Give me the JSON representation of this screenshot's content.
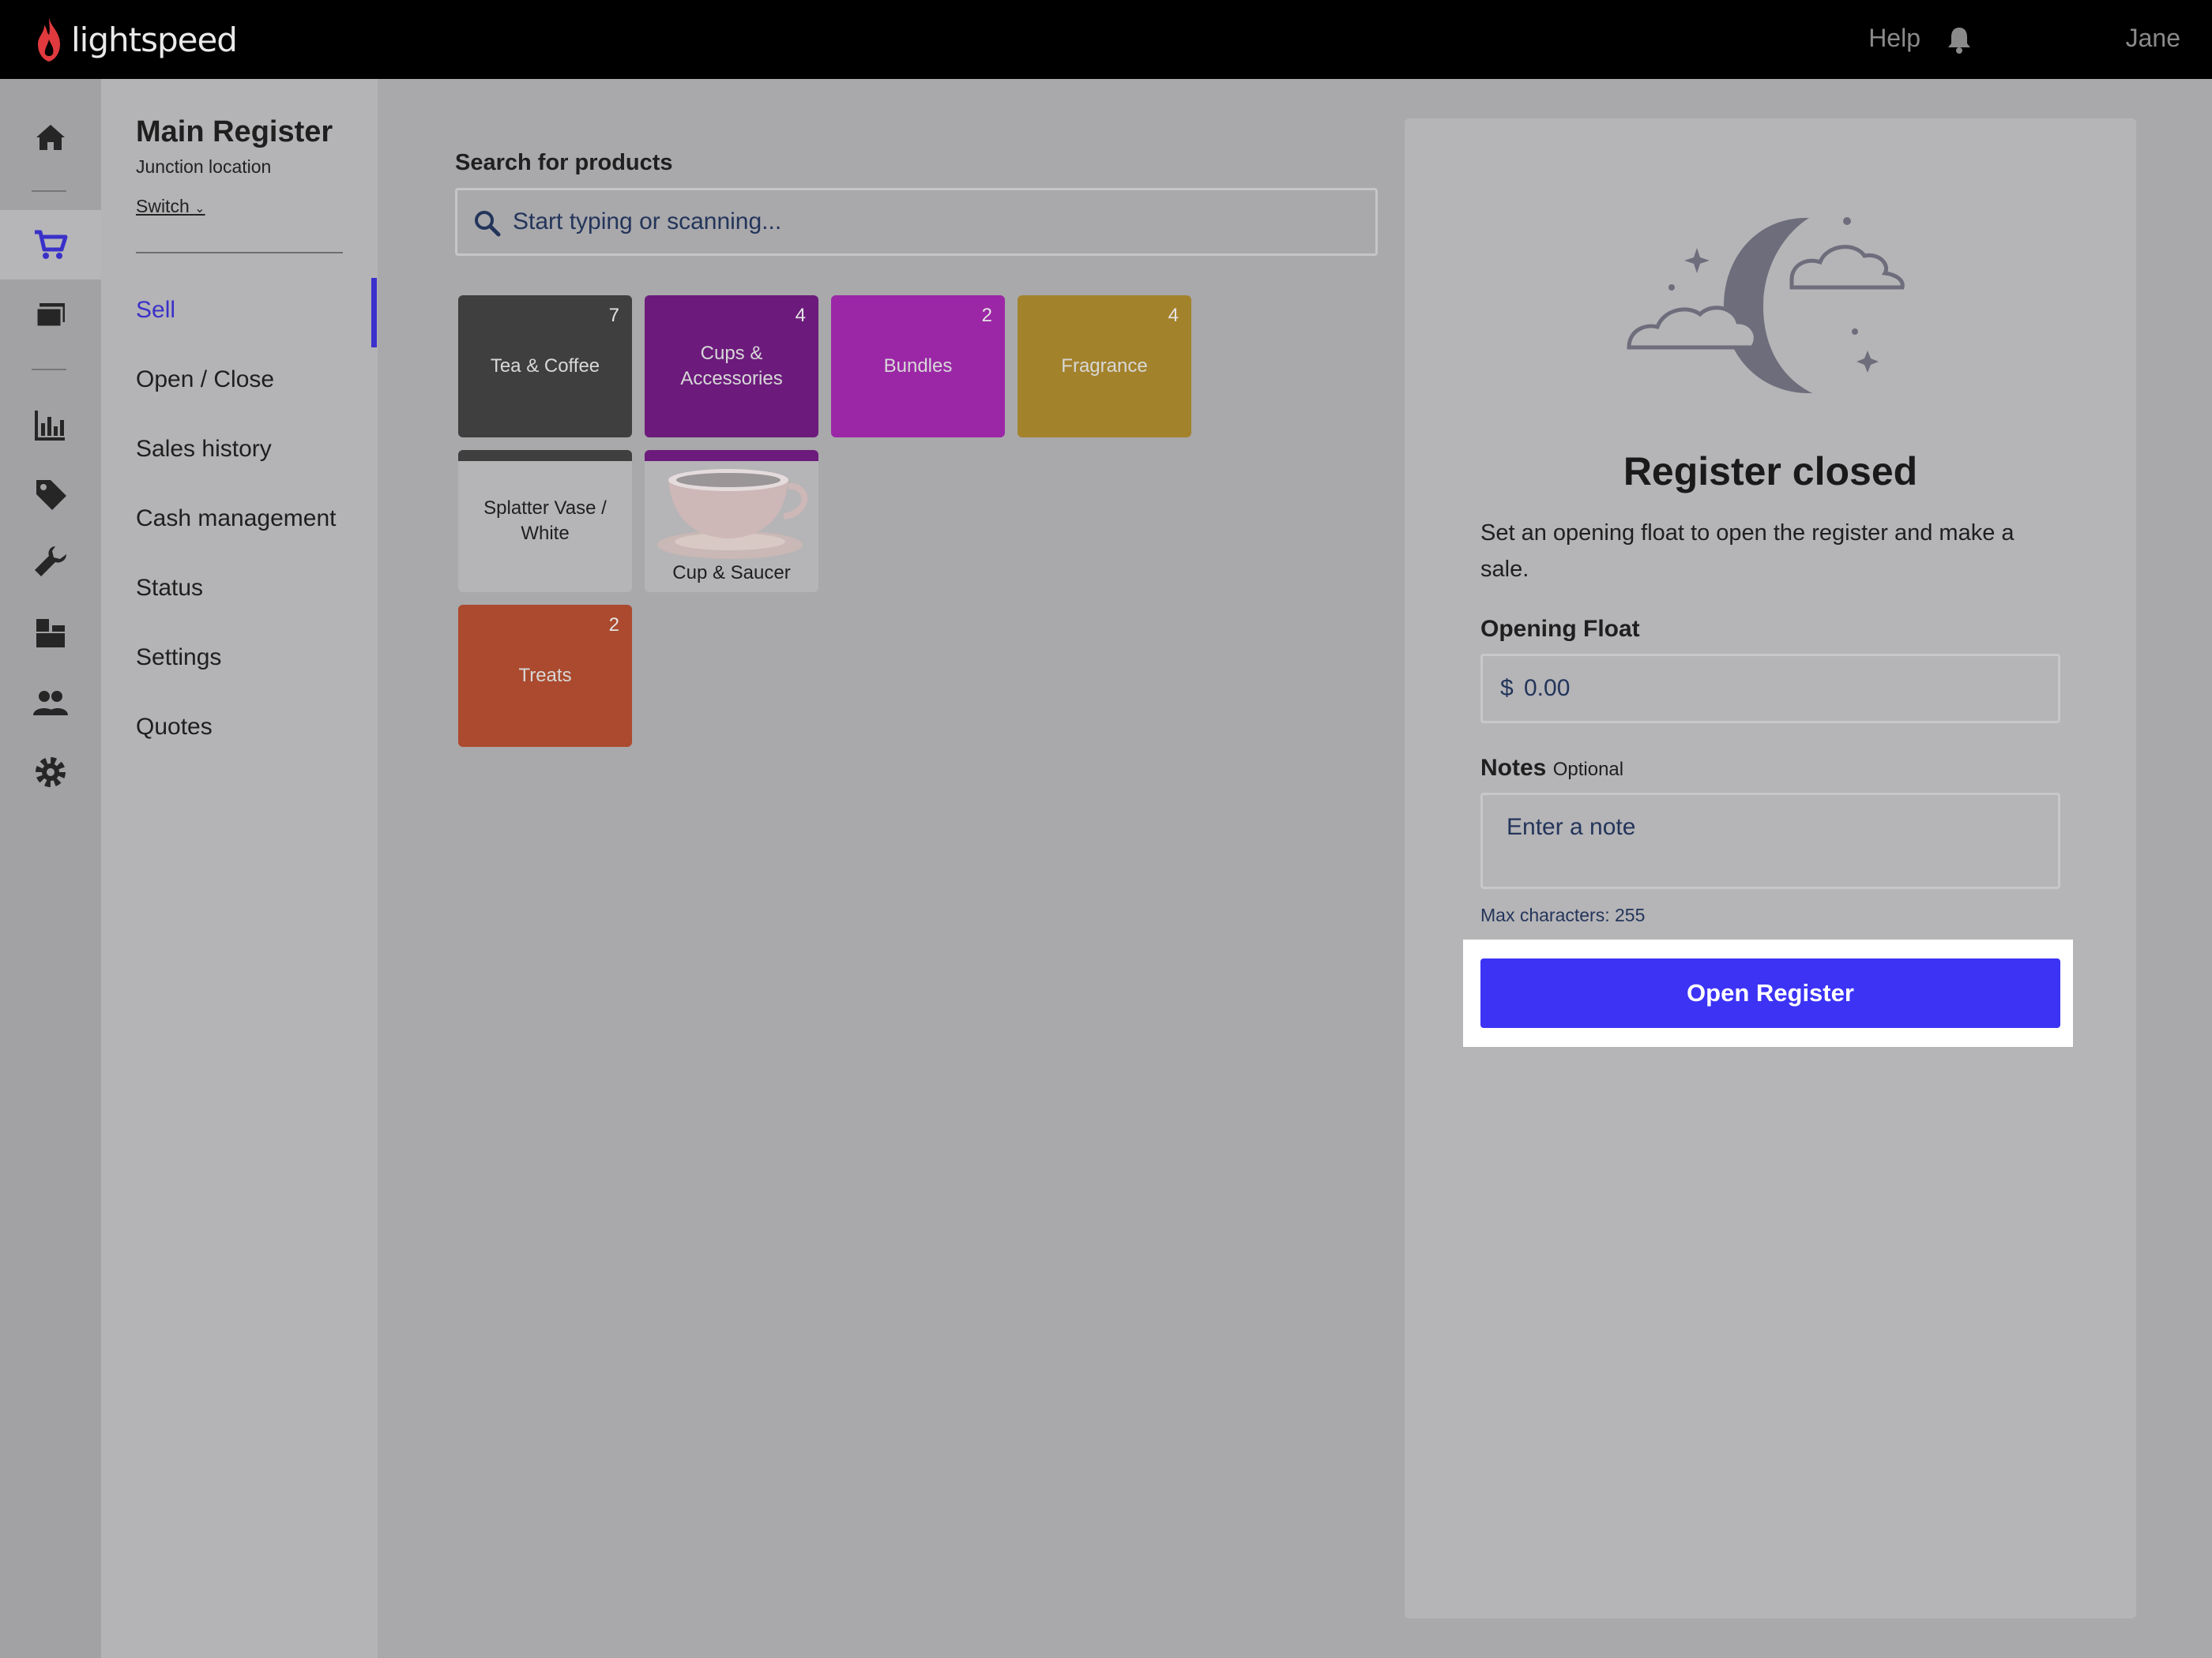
{
  "app": {
    "brand": "lightspeed",
    "brand_color": "#e03a3e",
    "accent": "#3c33f5"
  },
  "topbar": {
    "help": "Help",
    "user": "Jane"
  },
  "rail": {
    "icons": [
      "home-icon",
      "cart-icon",
      "register-icon",
      "reports-icon",
      "tag-icon",
      "wrench-icon",
      "inventory-icon",
      "customers-icon",
      "gear-icon",
      "collapse-icon"
    ],
    "active": "cart-icon"
  },
  "register": {
    "title": "Main Register",
    "location": "Junction location",
    "switch": "Switch"
  },
  "nav": {
    "items": [
      {
        "label": "Sell",
        "active": true
      },
      {
        "label": "Open / Close"
      },
      {
        "label": "Sales history"
      },
      {
        "label": "Cash management"
      },
      {
        "label": "Status"
      },
      {
        "label": "Settings"
      },
      {
        "label": "Quotes"
      }
    ]
  },
  "search": {
    "label": "Search for products",
    "placeholder": "Start typing or scanning..."
  },
  "tiles": [
    {
      "label": "Tea & Coffee",
      "count": "7",
      "color": "#3f3f3f"
    },
    {
      "label": "Cups & Accessories",
      "count": "4",
      "color": "#6c1b7c"
    },
    {
      "label": "Bundles",
      "count": "2",
      "color": "#9b27a6"
    },
    {
      "label": "Fragrance",
      "count": "4",
      "color": "#a3822c"
    },
    {
      "label": "Splatter Vase / White",
      "count": "",
      "color": "#b5b4b7"
    },
    {
      "label": "Cup & Saucer",
      "count": "",
      "color": "#b5b4b7"
    },
    {
      "label": "Treats",
      "count": "2",
      "color": "#ab4a2e"
    }
  ],
  "panel": {
    "title": "Register closed",
    "description": "Set an opening float to open the register and make a sale.",
    "float_label": "Opening Float",
    "currency": "$",
    "float_value": "0.00",
    "notes_label": "Notes",
    "notes_optional": "Optional",
    "notes_placeholder": "Enter a note",
    "max_chars": "Max characters: 255",
    "button": "Open Register"
  }
}
